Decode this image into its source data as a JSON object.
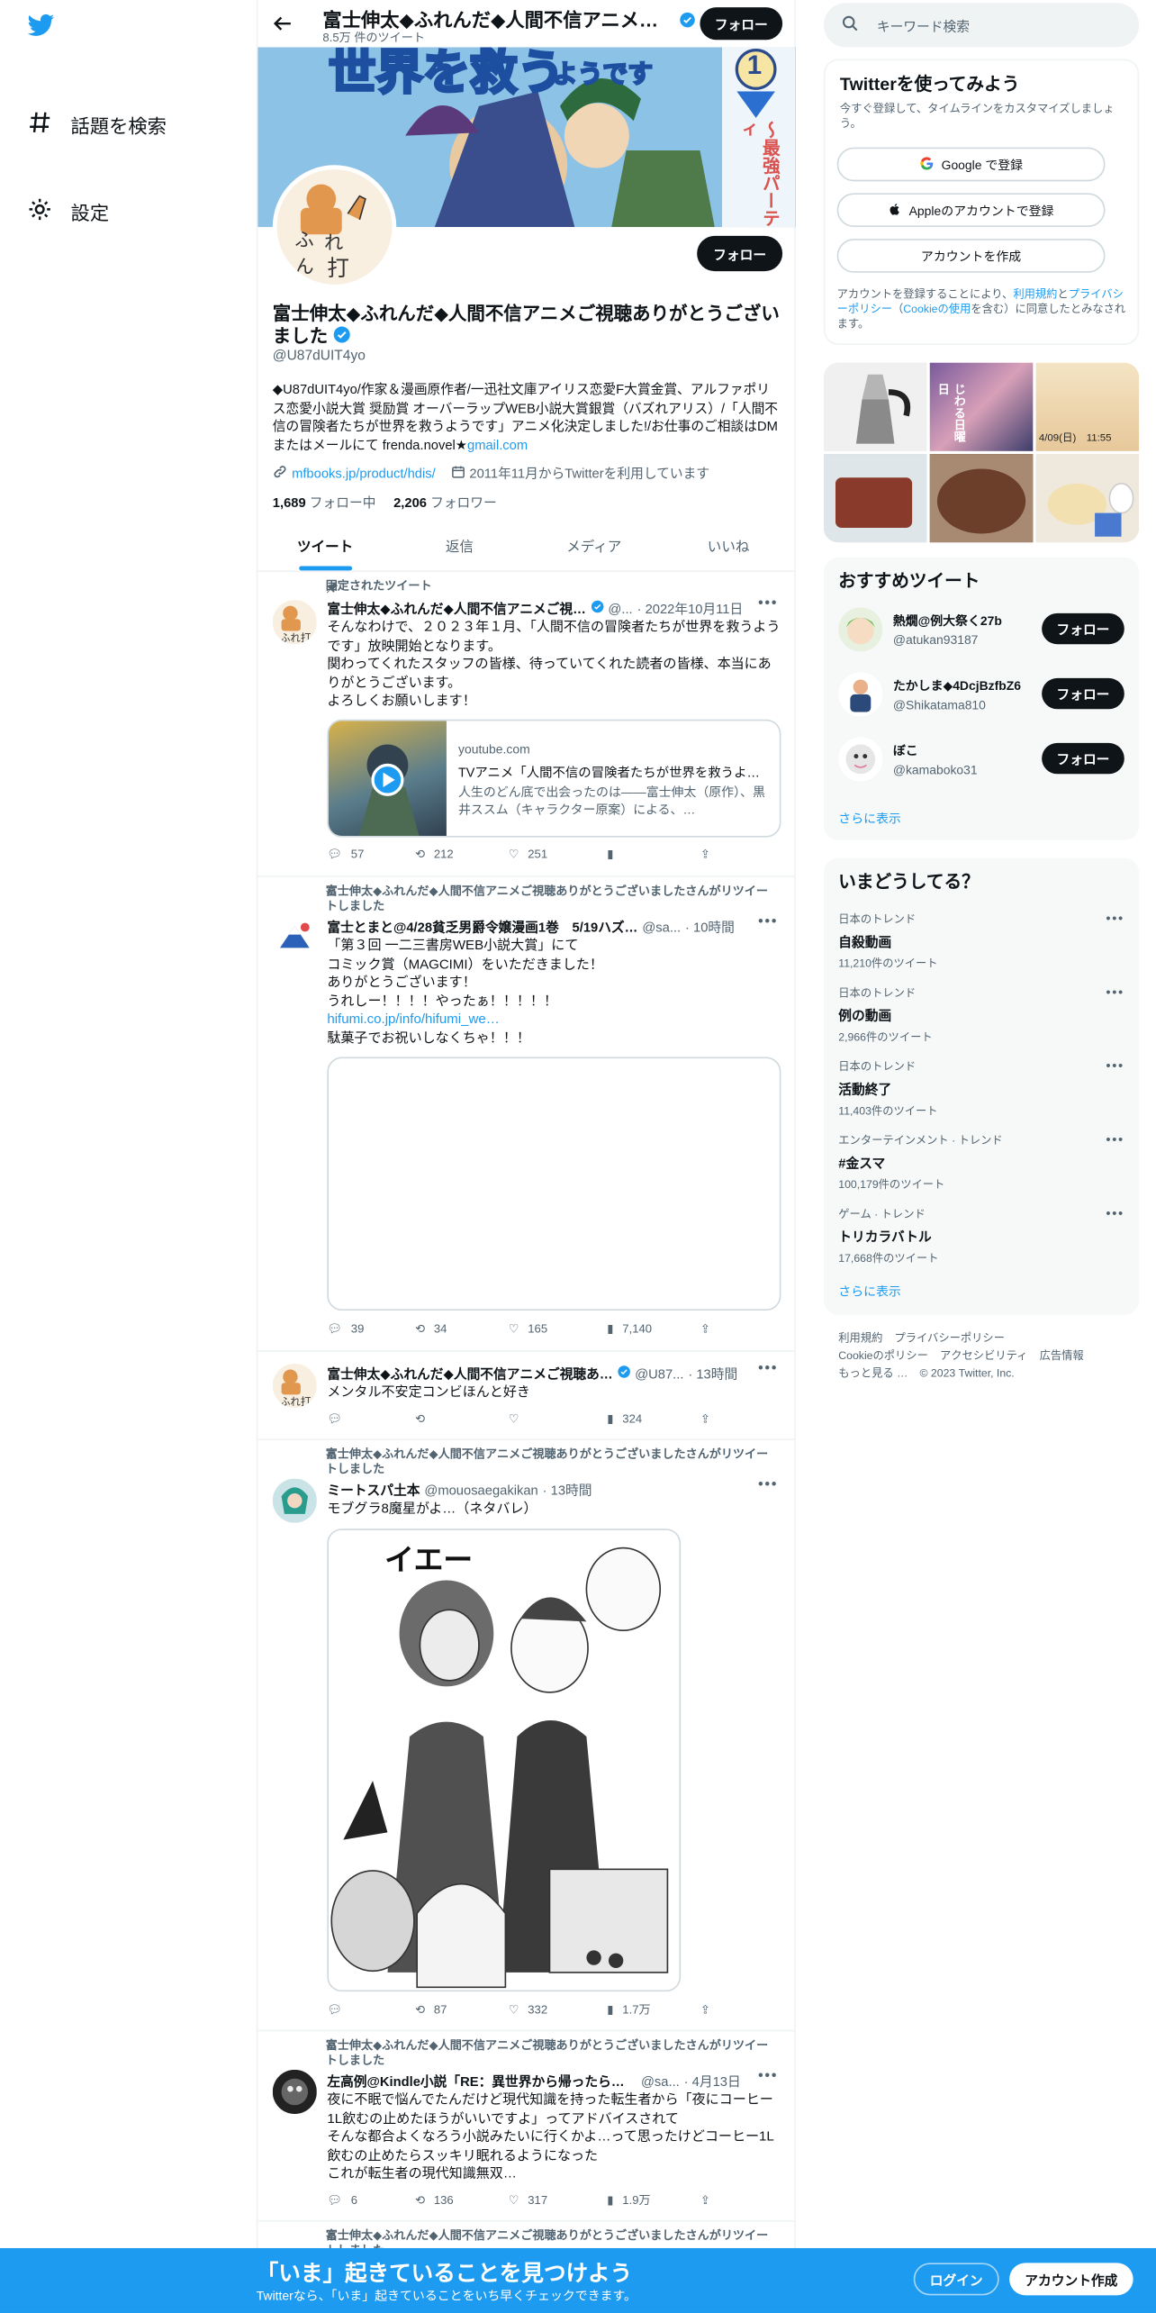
{
  "nav": {
    "explore_label": "話題を検索",
    "settings_label": "設定"
  },
  "profile": {
    "header_name": "富士伸太◆ふれんだ◆人間不信アニメご視聴ありがとうございました",
    "tweet_count": "8.5万 件のツイート",
    "follow_label": "フォロー",
    "name": "富士伸太◆ふれんだ◆人間不信アニメご視聴ありがとうございました",
    "handle": "@U87dUIT4yo",
    "bio": "◆U87dUIT4yo/作家＆漫画原作者/一迅社文庫アイリス恋愛F大賞金賞、アルファポリス恋愛小説大賞 奨励賞 オーバーラップWEB小説大賞銀賞（バズれアリス）/「人間不信の冒険者たちが世界を救うようです」アニメ化決定しました!/お仕事のご相談はDMまたはメールにて frenda.novel★",
    "bio_link": "gmail.com",
    "website": "mfbooks.jp/product/hdis/",
    "joined": "2011年11月からTwitterを利用しています",
    "following_count": "1,689",
    "following_label": "フォロー中",
    "followers_count": "2,206",
    "followers_label": "フォロワー",
    "banner_text": "世界を救う",
    "banner_sub": "ようです",
    "banner_vol": "1",
    "banner_side": "〜最強パーティ"
  },
  "tabs": [
    "ツイート",
    "返信",
    "メディア",
    "いいね"
  ],
  "tweets": [
    {
      "context": "固定されたツイート",
      "name": "富士伸太◆ふれんだ◆人間不信アニメご視…",
      "handle": "@...",
      "time": "· 2022年10月11日",
      "body": "そんなわけで、２０２３年１月、「人間不信の冒険者たちが世界を救うようです」放映開始となります。\n関わってくれたスタッフの皆様、待っていてくれた読者の皆様、本当にありがとうございます。\nよろしくお願いします！",
      "card_domain": "youtube.com",
      "card_title": "TVアニメ「人間不信の冒険者たちが世界を救うよ…",
      "card_desc": "人生のどん底で出会ったのは――富士伸太（原作）、黒井ススム（キャラクター原案）による、…",
      "replies": "57",
      "retweets": "212",
      "likes": "251"
    },
    {
      "context": "富士伸太◆ふれんだ◆人間不信アニメご視聴ありがとうございましたさんがリツイートしました",
      "name": "富士とまと@4/28貧乏男爵令嬢漫画1巻　5/19ハズ…",
      "handle": "@sa...",
      "time": "· 10時間",
      "body": "「第３回 一二三書房WEB小説大賞」にて\nコミック賞（MAGCIMI）をいただきました！\nありがとうございます！\nうれしー！！！！やったぁ！！！！！",
      "link": "hifumi.co.jp/info/hifumi_we…",
      "body2": "駄菓子でお祝いしなくちゃ！！！",
      "replies": "39",
      "retweets": "34",
      "likes": "165",
      "views": "7,140"
    },
    {
      "name": "富士伸太◆ふれんだ◆人間不信アニメご視聴あ…",
      "handle": "@U87...",
      "time": "· 13時間",
      "body": "メンタル不安定コンビほんと好き",
      "views": "324"
    },
    {
      "context": "富士伸太◆ふれんだ◆人間不信アニメご視聴ありがとうございましたさんがリツイートしました",
      "name": "ミートスパ土本",
      "handle": "@mouosaegakikan",
      "time": "· 13時間",
      "body": "モブグラ8魔星がよ…（ネタバレ）",
      "image_text": "イエー",
      "retweets": "87",
      "likes": "332",
      "views": "1.7万"
    },
    {
      "context": "富士伸太◆ふれんだ◆人間不信アニメご視聴ありがとうございましたさんがリツイートしました",
      "name": "左高例@Kindle小説「RE：異世界から帰ったら江…",
      "handle": "@sa...",
      "time": "· 4月13日",
      "body": "夜に不眠で悩んでたんだけど現代知識を持った転生者から「夜にコーヒー1L飲むの止めたほうがいいですよ」ってアドバイスされて\nそんな都合よくなろう小説みたいに行くかよ…って思ったけどコーヒー1L飲むの止めたらスッキリ眠れるようになった\nこれが転生者の現代知識無双…",
      "replies": "6",
      "retweets": "136",
      "likes": "317",
      "views": "1.9万"
    },
    {
      "context": "富士伸太◆ふれんだ◆人間不信アニメご視聴ありがとうございましたさんがリツイートしました"
    }
  ],
  "right": {
    "search_placeholder": "キーワード検索",
    "signup_title": "Twitterを使ってみよう",
    "signup_sub": "今すぐ登録して、タイムラインをカスタマイズしましょう。",
    "google_btn": "Google で登録",
    "apple_btn": "Appleのアカウントで登録",
    "create_btn": "アカウントを作成",
    "legal_1": "アカウントを登録することにより、",
    "legal_terms": "利用規約",
    "legal_2": "と",
    "legal_privacy": "プライバシーポリシー",
    "legal_3": "（",
    "legal_cookie": "Cookieの使用",
    "legal_4": "を含む）に同意したとみなされます。",
    "photo_texts": [
      "じわる日曜日",
      "4/09(日)　11:55"
    ],
    "reco_title": "おすすめツイート",
    "reco_users": [
      {
        "name": "熱燗@例大祭く27b",
        "handle": "@atukan93187"
      },
      {
        "name": "たかしま◆4DcjBzfbZ6",
        "handle": "@Shikatama810"
      },
      {
        "name": "ぼこ",
        "handle": "@kamaboko31"
      }
    ],
    "follow_label": "フォロー",
    "show_more": "さらに表示",
    "trends_title": "いまどうしてる？",
    "trends": [
      {
        "context": "日本のトレンド",
        "topic": "自殺動画",
        "count": "11,210件のツイート"
      },
      {
        "context": "日本のトレンド",
        "topic": "例の動画",
        "count": "2,966件のツイート"
      },
      {
        "context": "日本のトレンド",
        "topic": "活動終了",
        "count": "11,403件のツイート"
      },
      {
        "context": "エンターテインメント · トレンド",
        "topic": "#金スマ",
        "count": "100,179件のツイート"
      },
      {
        "context": "ゲーム · トレンド",
        "topic": "トリカラバトル",
        "count": "17,668件のツイート"
      }
    ],
    "footer": [
      "利用規約",
      "プライバシーポリシー",
      "Cookieのポリシー",
      "アクセシビリティ",
      "広告情報",
      "もっと見る …",
      "© 2023 Twitter, Inc."
    ]
  },
  "bottom": {
    "title": "「いま」起きていることを見つけよう",
    "subtitle": "Twitterなら、「いま」起きていることをいち早くチェックできます。",
    "login": "ログイン",
    "signup": "アカウント作成"
  },
  "colors": {
    "accent": "#1d9bf0",
    "text": "#0f1419",
    "muted": "#536471"
  }
}
